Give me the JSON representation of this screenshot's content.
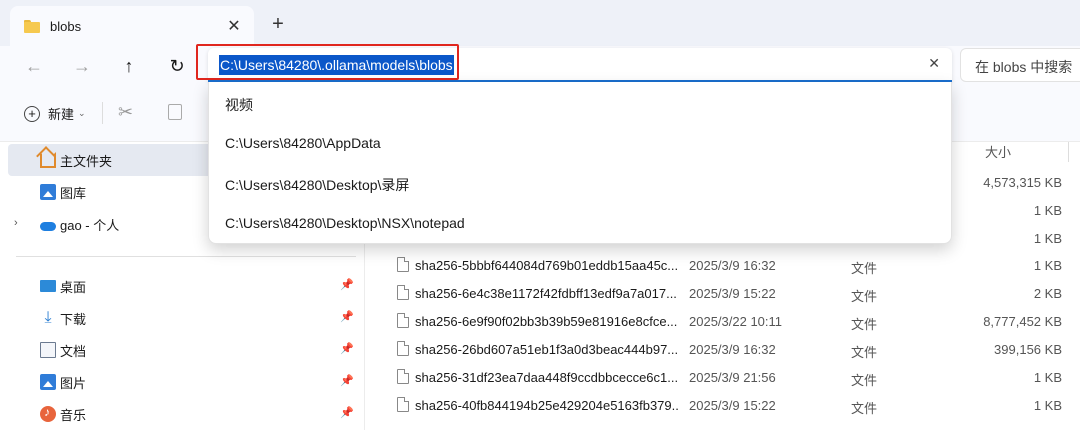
{
  "tab": {
    "title": "blobs",
    "close": "✕",
    "new_tab": "+"
  },
  "nav": {
    "back": "←",
    "forward": "→",
    "up": "↑",
    "refresh": "↻"
  },
  "address": {
    "value": "C:\\Users\\84280\\.ollama\\models\\blobs",
    "clear": "✕"
  },
  "search": {
    "placeholder": "在 blobs 中搜索"
  },
  "command_bar": {
    "new_label": "新建"
  },
  "suggestions": [
    "视频",
    "C:\\Users\\84280\\AppData",
    "C:\\Users\\84280\\Desktop\\录屏",
    "C:\\Users\\84280\\Desktop\\NSX\\notepad"
  ],
  "sidebar": {
    "home": "主文件夹",
    "gallery": "图库",
    "onedrive": "gao - 个人",
    "pinned": [
      "桌面",
      "下载",
      "文档",
      "图片",
      "音乐"
    ],
    "pin_glyph": "📌"
  },
  "files": {
    "size_header": "大小",
    "partial_sizes": [
      "4,573,315 KB",
      "1 KB",
      "1 KB"
    ],
    "rows": [
      {
        "name": "sha256-5bbbf644084d769b01eddb15aa45c...",
        "date": "2025/3/9 16:32",
        "type": "文件",
        "size": "1 KB"
      },
      {
        "name": "sha256-6e4c38e1172f42fdbff13edf9a7a017...",
        "date": "2025/3/9 15:22",
        "type": "文件",
        "size": "2 KB"
      },
      {
        "name": "sha256-6e9f90f02bb3b39b59e81916e8cfce...",
        "date": "2025/3/22 10:11",
        "type": "文件",
        "size": "8,777,452 KB"
      },
      {
        "name": "sha256-26bd607a51eb1f3a0d3beac444b97...",
        "date": "2025/3/9 16:32",
        "type": "文件",
        "size": "399,156 KB"
      },
      {
        "name": "sha256-31df23ea7daa448f9ccdbbcecce6c1...",
        "date": "2025/3/9 21:56",
        "type": "文件",
        "size": "1 KB"
      },
      {
        "name": "sha256-40fb844194b25e429204e5163fb379...",
        "date": "2025/3/9 15:22",
        "type": "文件",
        "size": "1 KB"
      }
    ]
  },
  "colors": {
    "accent": "#0b57c9",
    "highlight_box": "#e0261e",
    "folder": "#f6c94f"
  }
}
